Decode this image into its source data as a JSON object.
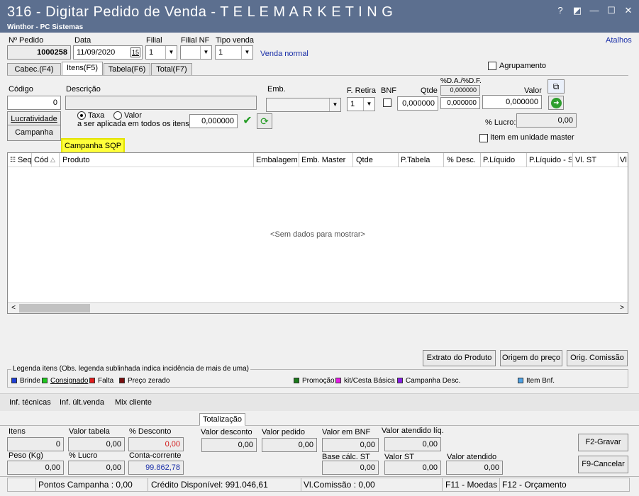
{
  "window": {
    "title": "316 - Digitar Pedido de Venda - T E L E M A R K E T I N G",
    "subtitle": "Winthor - PC Sistemas",
    "help": "?",
    "restore": "◩",
    "minimize": "—",
    "maximize": "☐",
    "close": "✕"
  },
  "header": {
    "atalhos": "Atalhos",
    "pedido_label": "Nº Pedido",
    "pedido_value": "1000258",
    "data_label": "Data",
    "data_value": "11/09/2020",
    "calendar_icon": "15",
    "filial_label": "Filial",
    "filial_value": "1",
    "filial_nf_label": "Filial NF",
    "filial_nf_value": "",
    "tipo_venda_label": "Tipo venda",
    "tipo_venda_value": "1",
    "tipo_venda_desc": "Venda normal"
  },
  "tabs": [
    "Cabec.(F4)",
    "Itens(F5)",
    "Tabela(F6)",
    "Total(F7)"
  ],
  "agrupamento": "Agrupamento",
  "item_form": {
    "codigo_label": "Código",
    "codigo_value": "0",
    "descricao_label": "Descrição",
    "emb_label": "Emb.",
    "f_retira_label": "F. Retira",
    "f_retira_value": "1",
    "bnf_label": "BNF",
    "qtde_label": "Qtde",
    "qtde_value": "0,000000",
    "da_df_label": "%D.A./%D.F.",
    "da_value": "0,000000",
    "df_value": "0,000000",
    "valor_label": "Valor",
    "valor_value": "0,000000",
    "lucratividade": "Lucratividade",
    "campanha": "Campanha",
    "taxa": "Taxa",
    "valor_radio": "Valor",
    "aplicada_label": "a ser aplicada em todos os itens:",
    "aplicada_value": "0,000000",
    "lucro_label": "% Lucro:",
    "lucro_value": "0,00",
    "item_master": "Item em unidade master",
    "campanha_sqp": "Campanha SQP"
  },
  "grid": {
    "columns": [
      "Seq",
      "Cód",
      "Produto",
      "Embalagem",
      "Emb. Master",
      "Qtde",
      "P.Tabela",
      "% Desc.",
      "P.Líquido",
      "P.Líquido - S",
      "Vl. ST",
      "Vl."
    ],
    "empty": "<Sem dados para mostrar>",
    "scroll_left": "<",
    "scroll_right": ">"
  },
  "actions": {
    "extrato": "Extrato do Produto",
    "origem": "Origem do preço",
    "comissao": "Orig. Comissão"
  },
  "legend": {
    "title": "Legenda itens (Obs. legenda sublinhada indica incidência de mais de uma)",
    "items": [
      {
        "label": "Brinde",
        "color": "#1f3fd6"
      },
      {
        "label": "Consignado",
        "color": "#1ec81e"
      },
      {
        "label": "Falta",
        "color": "#e01c1c"
      },
      {
        "label": "Preço zerado",
        "color": "#7a1010"
      },
      {
        "label": "Promoção",
        "color": "#1a7a1a"
      },
      {
        "label": "kit/Cesta Básica",
        "color": "#e61ee6"
      },
      {
        "label": "Campanha Desc.",
        "color": "#8a1ee6"
      },
      {
        "label": "Item Bnf.",
        "color": "#4fa3e6"
      }
    ]
  },
  "info_tabs": [
    "Inf. técnicas",
    "Inf. últ.venda",
    "Mix cliente"
  ],
  "totalizacao": {
    "tab": "Totalização",
    "itens_label": "Itens",
    "itens_value": "0",
    "valor_tabela_label": "Valor tabela",
    "valor_tabela_value": "0,00",
    "pct_desconto_label": "% Desconto",
    "pct_desconto_value": "0,00",
    "valor_desconto_label": "Valor desconto",
    "valor_desconto_value": "0,00",
    "valor_pedido_label": "Valor pedido",
    "valor_pedido_value": "0,00",
    "valor_bnf_label": "Valor em BNF",
    "valor_bnf_value": "0,00",
    "valor_atendido_liq_label": "Valor atendido líq.",
    "valor_atendido_liq_value": "0,00",
    "peso_label": "Peso (Kg)",
    "peso_value": "0,00",
    "pct_lucro_label": "% Lucro",
    "pct_lucro_value": "0,00",
    "conta_corrente_label": "Conta-corrente",
    "conta_corrente_value": "99.862,78",
    "base_st_label": "Base cálc. ST",
    "base_st_value": "0,00",
    "valor_st_label": "Valor ST",
    "valor_st_value": "0,00",
    "valor_atendido_label": "Valor atendido",
    "valor_atendido_value": "0,00",
    "gravar": "F2-Gravar",
    "cancelar": "F9-Cancelar"
  },
  "statusbar": {
    "pontos": "Pontos Campanha : 0,00",
    "credito": "Crédito Disponível: 991.046,61",
    "comissao": "Vl.Comissão : 0,00",
    "moedas": "F11 - Moedas",
    "orcamento": "F12 - Orçamento"
  }
}
